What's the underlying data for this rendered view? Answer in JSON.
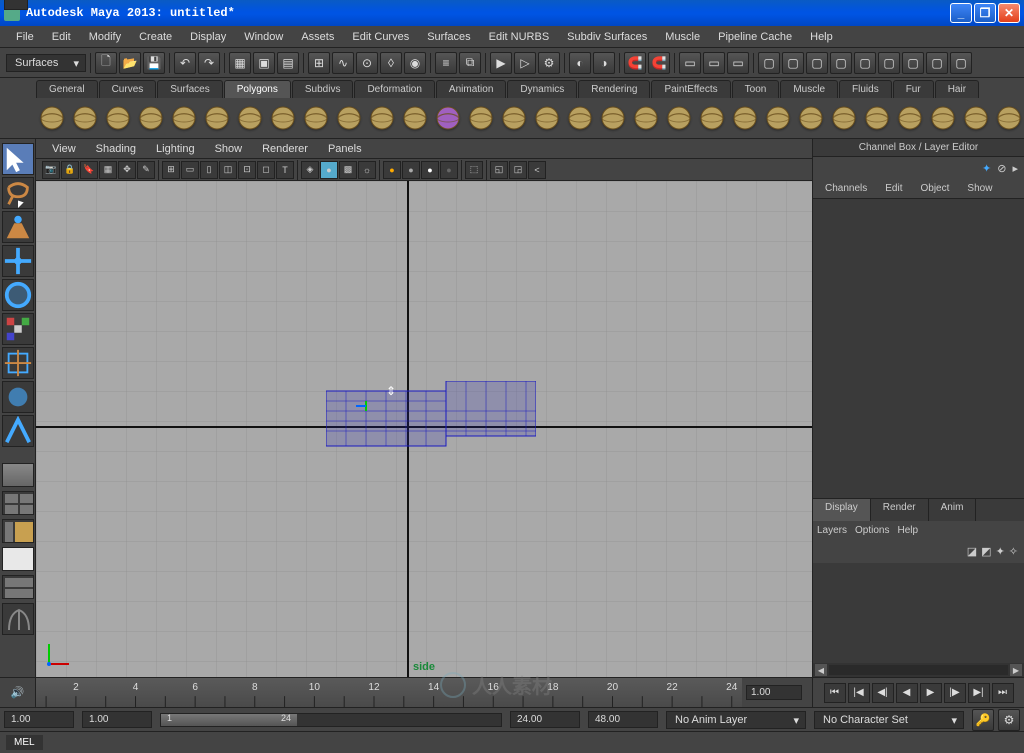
{
  "titlebar": {
    "title": "Autodesk Maya 2013: untitled*"
  },
  "menubar": [
    "File",
    "Edit",
    "Modify",
    "Create",
    "Display",
    "Window",
    "Assets",
    "Edit Curves",
    "Surfaces",
    "Edit NURBS",
    "Subdiv Surfaces",
    "Muscle",
    "Pipeline Cache",
    "Help"
  ],
  "maintoolbar": {
    "module_dropdown": "Surfaces"
  },
  "shelf": {
    "tabs": [
      "General",
      "Curves",
      "Surfaces",
      "Polygons",
      "Subdivs",
      "Deformation",
      "Animation",
      "Dynamics",
      "Rendering",
      "PaintEffects",
      "Toon",
      "Muscle",
      "Fluids",
      "Fur",
      "Hair"
    ],
    "active_tab": 3,
    "icons": [
      "sphere",
      "cube",
      "cylinder",
      "cone",
      "plane",
      "torus",
      "prism",
      "pyramid",
      "pipe",
      "helix",
      "soccer",
      "platonic",
      "poly-cube-purple",
      "type",
      "append",
      "combine",
      "split",
      "extract",
      "triangulate",
      "quad",
      "smooth",
      "bevel",
      "extrude",
      "bridge",
      "merge",
      "crease",
      "sculpt",
      "planar-map",
      "cyl-map",
      "sphere-map"
    ]
  },
  "toolbox": {
    "tools": [
      "select",
      "lasso",
      "paint-select",
      "move",
      "rotate",
      "scale",
      "universal",
      "soft-select",
      "show-manip"
    ],
    "layouts": [
      "single",
      "four",
      "two-side",
      "two-stack",
      "outliner",
      "maya-logo"
    ]
  },
  "viewport": {
    "menus": [
      "View",
      "Shading",
      "Lighting",
      "Show",
      "Renderer",
      "Panels"
    ],
    "view_label": "side"
  },
  "channelbox": {
    "title": "Channel Box / Layer Editor",
    "tabs": [
      "Channels",
      "Edit",
      "Object",
      "Show"
    ]
  },
  "layers": {
    "tabs": [
      "Display",
      "Render",
      "Anim"
    ],
    "active_tab": 0,
    "menu": [
      "Layers",
      "Options",
      "Help"
    ]
  },
  "timeline": {
    "ticks": [
      2,
      4,
      6,
      8,
      10,
      12,
      14,
      16,
      18,
      20,
      22,
      24
    ],
    "current_end": "1.00"
  },
  "range": {
    "start": "1.00",
    "in": "1.00",
    "current": "1",
    "out": "24",
    "end_a": "24.00",
    "end_b": "48.00",
    "anim_layer": "No Anim Layer",
    "character_set": "No Character Set"
  },
  "cmdline": {
    "lang": "MEL"
  },
  "watermark": {
    "text": "人人素材"
  }
}
